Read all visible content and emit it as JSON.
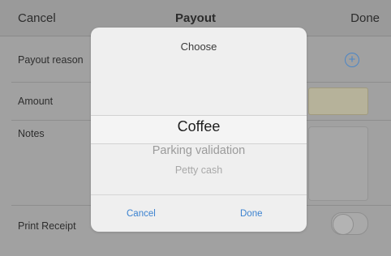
{
  "navbar": {
    "cancel_label": "Cancel",
    "title": "Payout",
    "done_label": "Done"
  },
  "form": {
    "payout_reason_label": "Payout reason",
    "amount_label": "Amount",
    "notes_label": "Notes",
    "print_receipt_label": "Print Receipt",
    "print_receipt_on": false
  },
  "picker": {
    "title": "Choose",
    "options": [
      "Coffee",
      "Parking validation",
      "Petty cash"
    ],
    "selected": "Coffee",
    "cancel_label": "Cancel",
    "done_label": "Done"
  },
  "colors": {
    "accent": "#3b82d0",
    "amount_highlight": "#b6b29a"
  },
  "icons": {
    "add": "add-circle-icon"
  }
}
